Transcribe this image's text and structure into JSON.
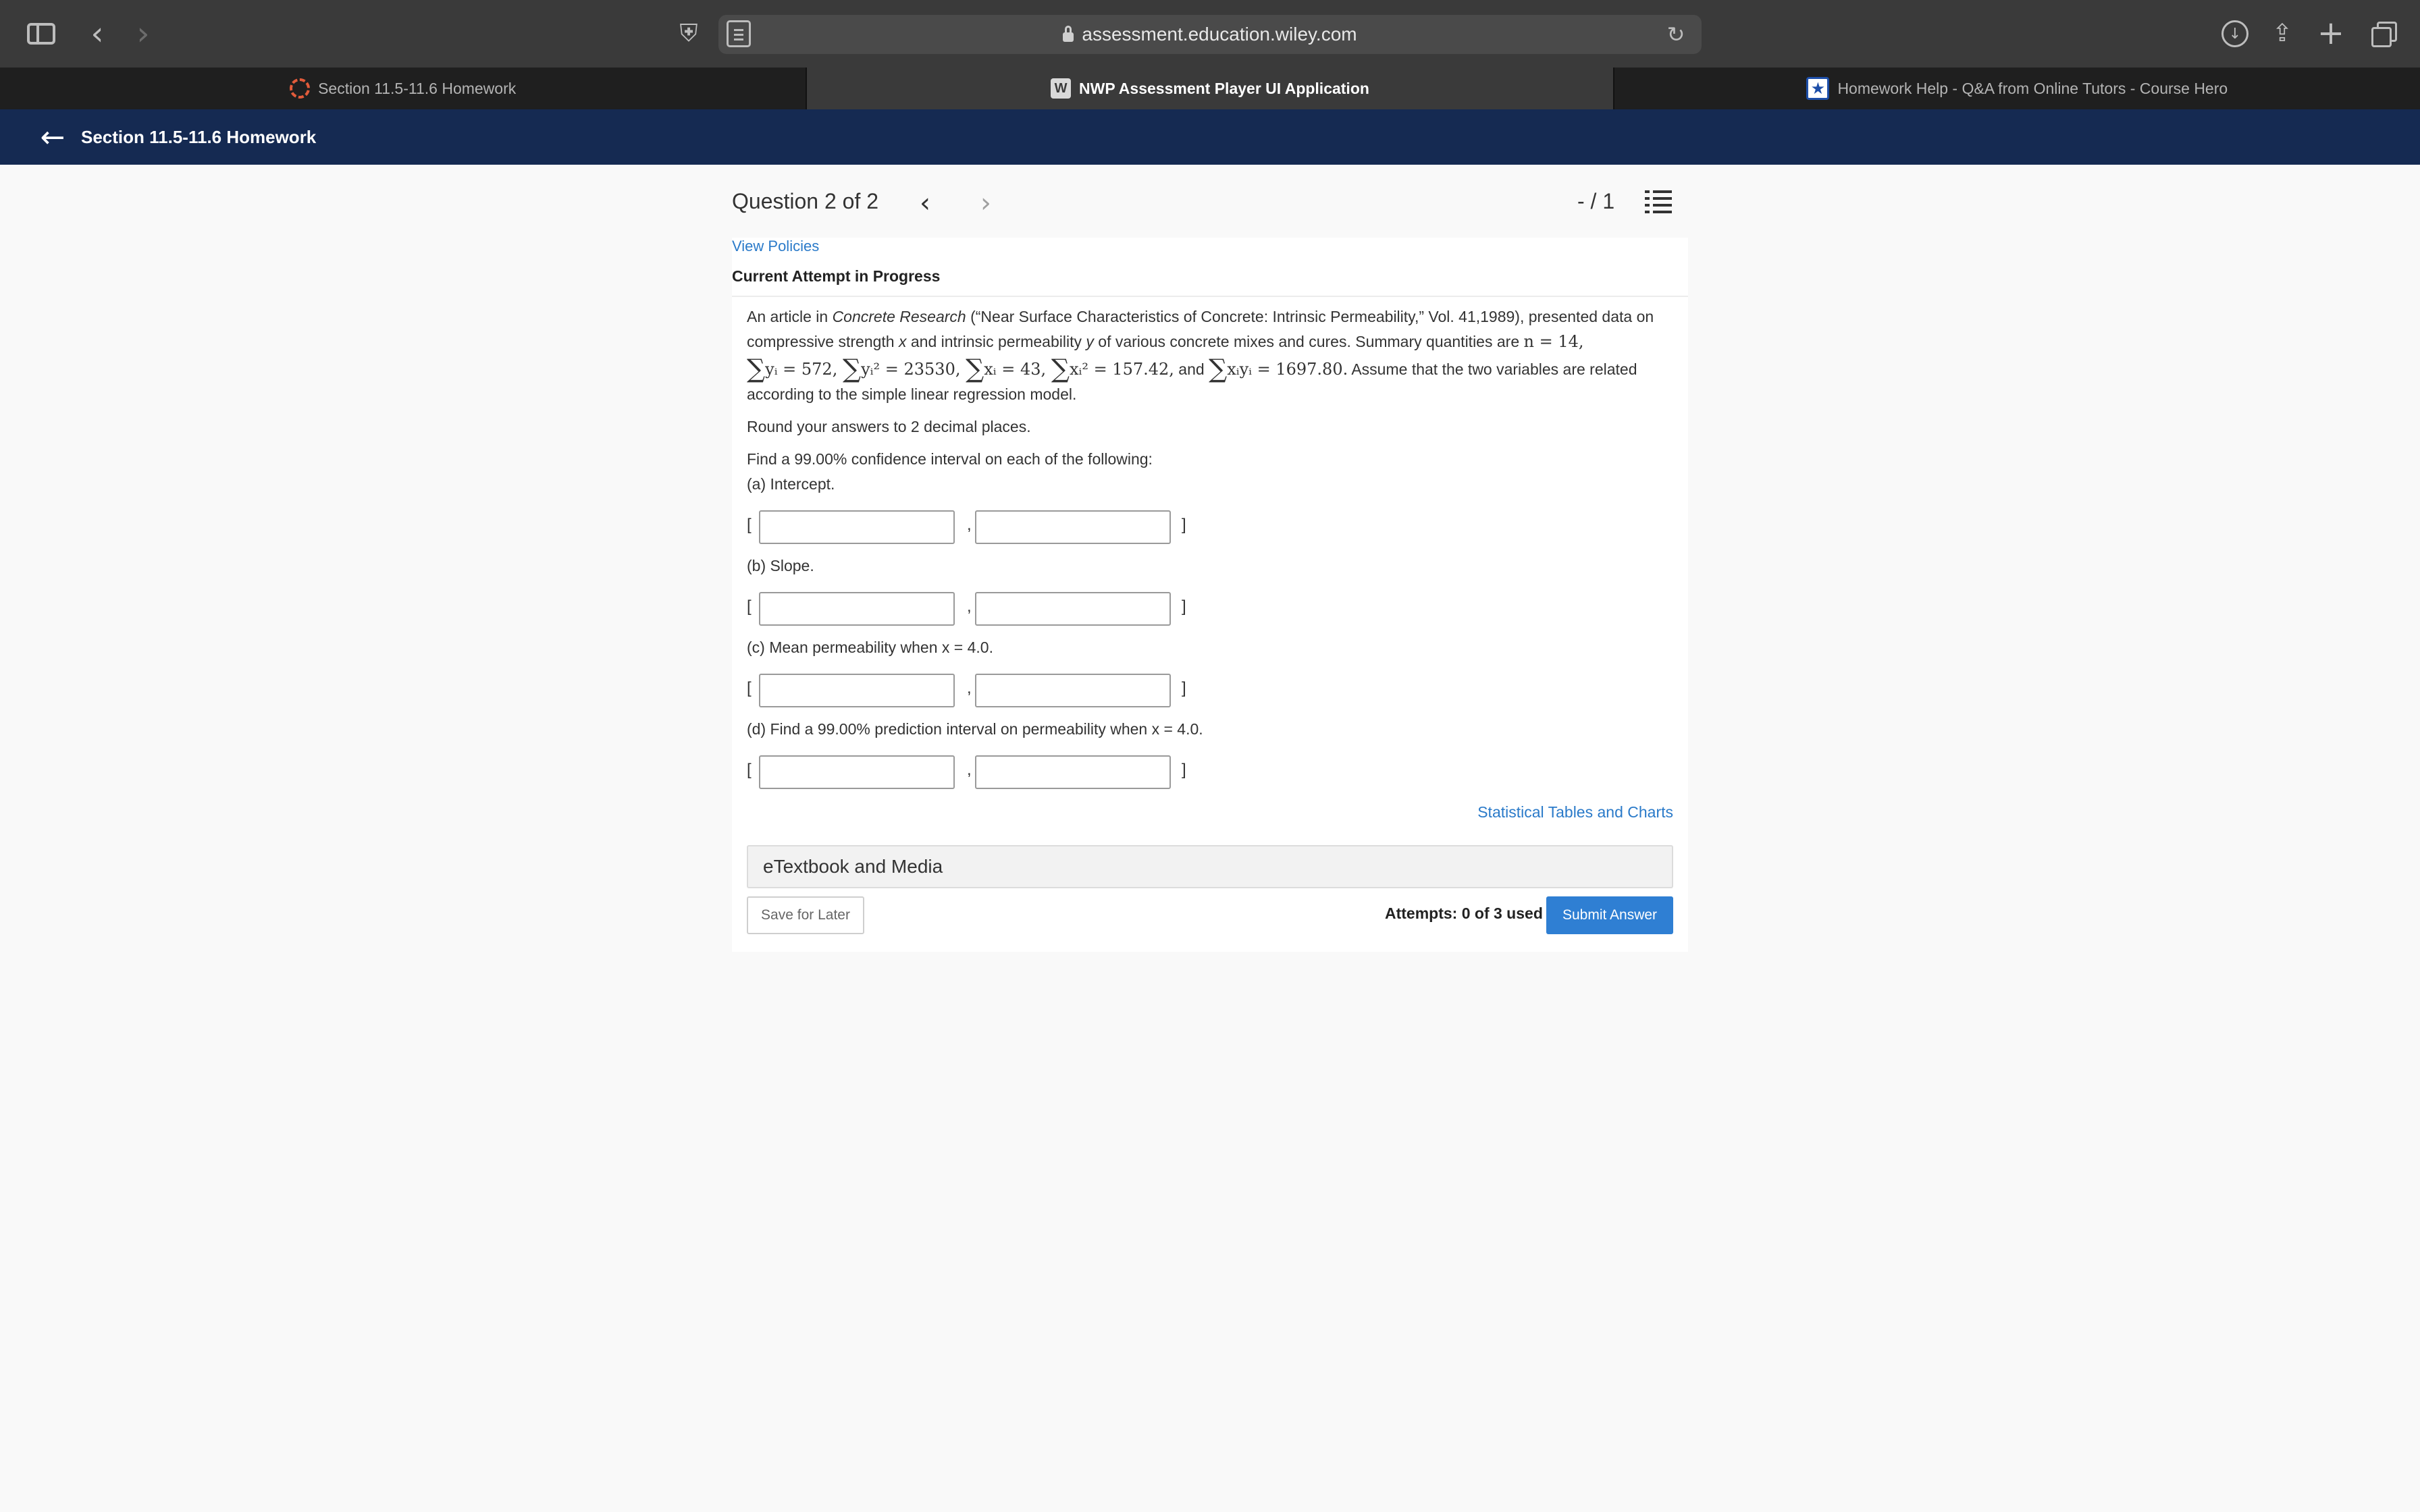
{
  "browser": {
    "url": "assessment.education.wiley.com",
    "tabs": [
      {
        "label": "Section 11.5-11.6 Homework",
        "active": false
      },
      {
        "label": "NWP Assessment Player UI Application",
        "active": true
      },
      {
        "label": "Homework Help - Q&A from Online Tutors - Course Hero",
        "active": false
      }
    ]
  },
  "app": {
    "title": "Section 11.5-11.6 Homework"
  },
  "question_nav": {
    "position": "Question 2 of 2",
    "score": "- / 1"
  },
  "card": {
    "view_policies": "View Policies",
    "attempt_heading": "Current Attempt in Progress",
    "intro_1": "An article in ",
    "journal": "Concrete Research",
    "intro_2": " (“Near Surface Characteristics of Concrete: Intrinsic Permeability,” Vol. 41,1989), presented data on compressive strength ",
    "var_x": "x",
    "intro_3": " and intrinsic permeability ",
    "var_y": "y",
    "intro_4": " of various concrete mixes and cures. Summary quantities are ",
    "n_expr": "n = 14,",
    "sum_y": "yᵢ = 572,",
    "sum_y2": "yᵢ² = 23530,",
    "sum_x": "xᵢ = 43,",
    "sum_x2": "xᵢ² = 157.42,",
    "and_word": " and ",
    "sum_xy": "xᵢyᵢ = 1697.80.",
    "intro_5": " Assume that the two variables are related according to the simple linear regression model.",
    "round_note": "Round your answers to 2 decimal places.",
    "find_note": "Find a 99.00% confidence interval on each of the following:",
    "parts": [
      {
        "label": "(a) Intercept.",
        "lower": "",
        "upper": ""
      },
      {
        "label": "(b) Slope.",
        "lower": "",
        "upper": ""
      },
      {
        "label": "(c) Mean permeability when x = 4.0.",
        "lower": "",
        "upper": ""
      },
      {
        "label": "(d) Find a 99.00% prediction interval on permeability when x = 4.0.",
        "lower": "",
        "upper": ""
      }
    ],
    "bracket_open": "[",
    "comma": ",",
    "bracket_close": "]",
    "stat_tables": "Statistical Tables and Charts",
    "etextbook": "eTextbook and Media",
    "save_later": "Save for Later",
    "attempts": "Attempts: 0 of 3 used",
    "submit": "Submit Answer"
  }
}
